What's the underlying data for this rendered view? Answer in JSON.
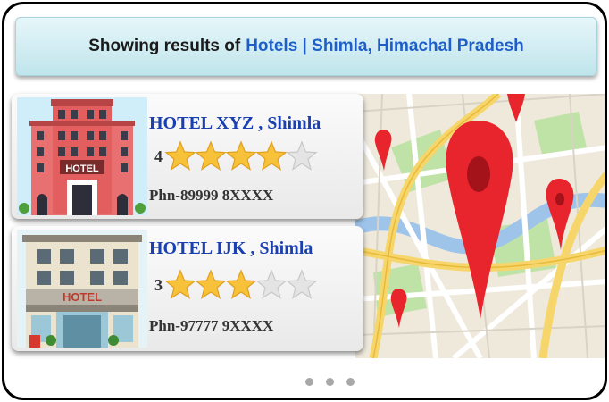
{
  "header": {
    "prefix": "Showing results of",
    "query": "Hotels | Shimla, Himachal Pradesh"
  },
  "results": [
    {
      "name": "HOTEL XYZ , Shimla",
      "rating": 4,
      "rating_label": "4",
      "max_rating": 5,
      "phone": "Phn-89999 8XXXX",
      "sign_text": "HOTEL"
    },
    {
      "name": "HOTEL IJK , Shimla",
      "rating": 3,
      "rating_label": "3",
      "max_rating": 5,
      "phone": "Phn-97777 9XXXX",
      "sign_text": "HOTEL"
    }
  ],
  "pagination": {
    "dots": 3
  },
  "colors": {
    "accent": "#1e5ec8",
    "hotel_name": "#1a3fb0",
    "star_filled": "#f7c23a",
    "star_empty": "#e4e4e4",
    "pin": "#e8242c"
  },
  "icons": {
    "map": "map-with-pins",
    "star": "star-icon",
    "pin": "map-pin-icon"
  }
}
